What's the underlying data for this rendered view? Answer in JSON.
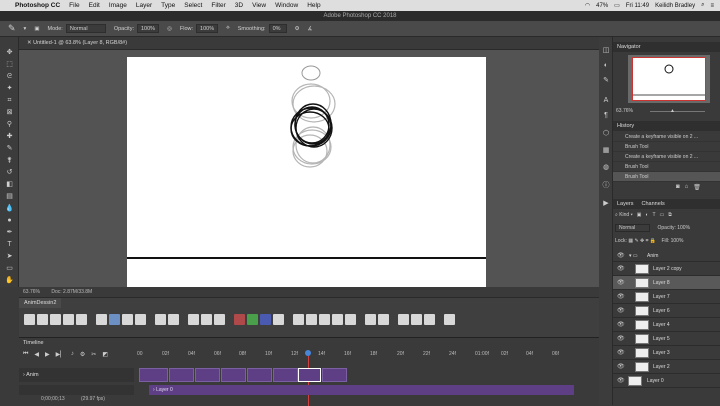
{
  "menubar": {
    "apple": "",
    "app": "Photoshop CC",
    "items": [
      "File",
      "Edit",
      "Image",
      "Layer",
      "Type",
      "Select",
      "Filter",
      "3D",
      "View",
      "Window",
      "Help"
    ],
    "status": {
      "battery": "47%",
      "time": "Fri 11:49",
      "user": "Keilidh Bradley"
    }
  },
  "titlebar": {
    "title": "Adobe Photoshop CC 2018"
  },
  "options": {
    "mode_label": "Mode:",
    "mode": "Normal",
    "opacity_label": "Opacity:",
    "opacity": "100%",
    "flow_label": "Flow:",
    "flow": "100%",
    "smoothing_label": "Smoothing:",
    "smoothing": "0%"
  },
  "doc": {
    "tab": "Untitled-1 @ 63.8% (Layer 8, RGB/8#)",
    "zoom": "63.76%",
    "docinfo": "Doc: 2.87M/33.8M"
  },
  "actions": {
    "tab": "AnimDessin2"
  },
  "timeline": {
    "label": "Timeline",
    "ticks": [
      "00",
      "02f",
      "04f",
      "06f",
      "08f",
      "10f",
      "12f",
      "14f",
      "16f",
      "18f",
      "20f",
      "22f",
      "24f",
      "01:00f",
      "02f",
      "04f",
      "06f"
    ],
    "track_anim": "Anim",
    "track_layer0": "Layer 0",
    "timecode": "0;00;00;13",
    "fps": "(29.97 fps)"
  },
  "navigator": {
    "title": "Navigator",
    "zoom": "63.76%"
  },
  "history": {
    "title": "History",
    "items": [
      "Create a keyframe visible on 2 ...",
      "Brush Tool",
      "Create a keyframe visible on 2 ...",
      "Brush Tool",
      "Brush Tool"
    ]
  },
  "layers": {
    "tabs": [
      "Layers",
      "Channels"
    ],
    "kind": "Kind",
    "blend": "Normal",
    "opacity_label": "Opacity:",
    "opacity": "100%",
    "lock_label": "Lock:",
    "fill_label": "Fill:",
    "fill": "100%",
    "group": "Anim",
    "items": [
      "Layer 2 copy",
      "Layer 8",
      "Layer 7",
      "Layer 6",
      "Layer 4",
      "Layer 5",
      "Layer 3",
      "Layer 2",
      "Layer 0"
    ]
  }
}
